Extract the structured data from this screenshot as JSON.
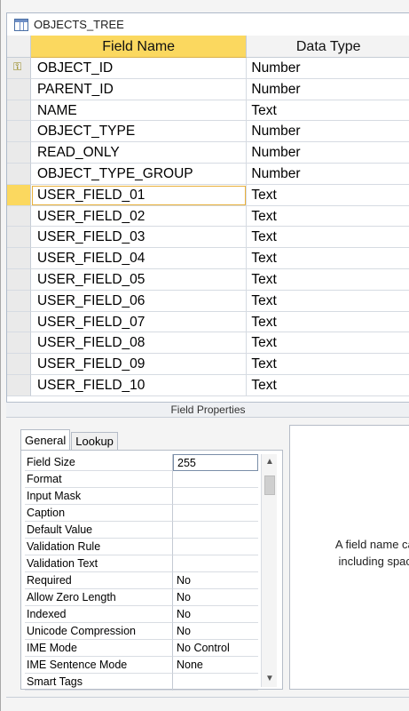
{
  "document": {
    "title": "OBJECTS_TREE",
    "icon": "table-icon"
  },
  "grid": {
    "headers": {
      "field_name": "Field Name",
      "data_type": "Data Type"
    },
    "rows": [
      {
        "name": "OBJECT_ID",
        "type": "Number",
        "primary_key": true
      },
      {
        "name": "PARENT_ID",
        "type": "Number"
      },
      {
        "name": "NAME",
        "type": "Text"
      },
      {
        "name": "OBJECT_TYPE",
        "type": "Number"
      },
      {
        "name": "READ_ONLY",
        "type": "Number"
      },
      {
        "name": "OBJECT_TYPE_GROUP",
        "type": "Number"
      },
      {
        "name": "USER_FIELD_01",
        "type": "Text",
        "current": true
      },
      {
        "name": "USER_FIELD_02",
        "type": "Text"
      },
      {
        "name": "USER_FIELD_03",
        "type": "Text"
      },
      {
        "name": "USER_FIELD_04",
        "type": "Text"
      },
      {
        "name": "USER_FIELD_05",
        "type": "Text"
      },
      {
        "name": "USER_FIELD_06",
        "type": "Text"
      },
      {
        "name": "USER_FIELD_07",
        "type": "Text"
      },
      {
        "name": "USER_FIELD_08",
        "type": "Text"
      },
      {
        "name": "USER_FIELD_09",
        "type": "Text"
      },
      {
        "name": "USER_FIELD_10",
        "type": "Text"
      }
    ]
  },
  "field_properties": {
    "title": "Field Properties",
    "tabs": [
      "General",
      "Lookup"
    ],
    "active_tab": "General",
    "properties": [
      {
        "label": "Field Size",
        "value": "255"
      },
      {
        "label": "Format",
        "value": ""
      },
      {
        "label": "Input Mask",
        "value": ""
      },
      {
        "label": "Caption",
        "value": ""
      },
      {
        "label": "Default Value",
        "value": ""
      },
      {
        "label": "Validation Rule",
        "value": ""
      },
      {
        "label": "Validation Text",
        "value": ""
      },
      {
        "label": "Required",
        "value": "No"
      },
      {
        "label": "Allow Zero Length",
        "value": "No"
      },
      {
        "label": "Indexed",
        "value": "No"
      },
      {
        "label": "Unicode Compression",
        "value": "No"
      },
      {
        "label": "IME Mode",
        "value": "No Control"
      },
      {
        "label": "IME Sentence Mode",
        "value": "None"
      },
      {
        "label": "Smart Tags",
        "value": ""
      }
    ],
    "help_text_line1": "A field name can be",
    "help_text_line2": "including spaces. I"
  },
  "colors": {
    "accent": "#fbd85f",
    "border": "#b5bcc7"
  }
}
